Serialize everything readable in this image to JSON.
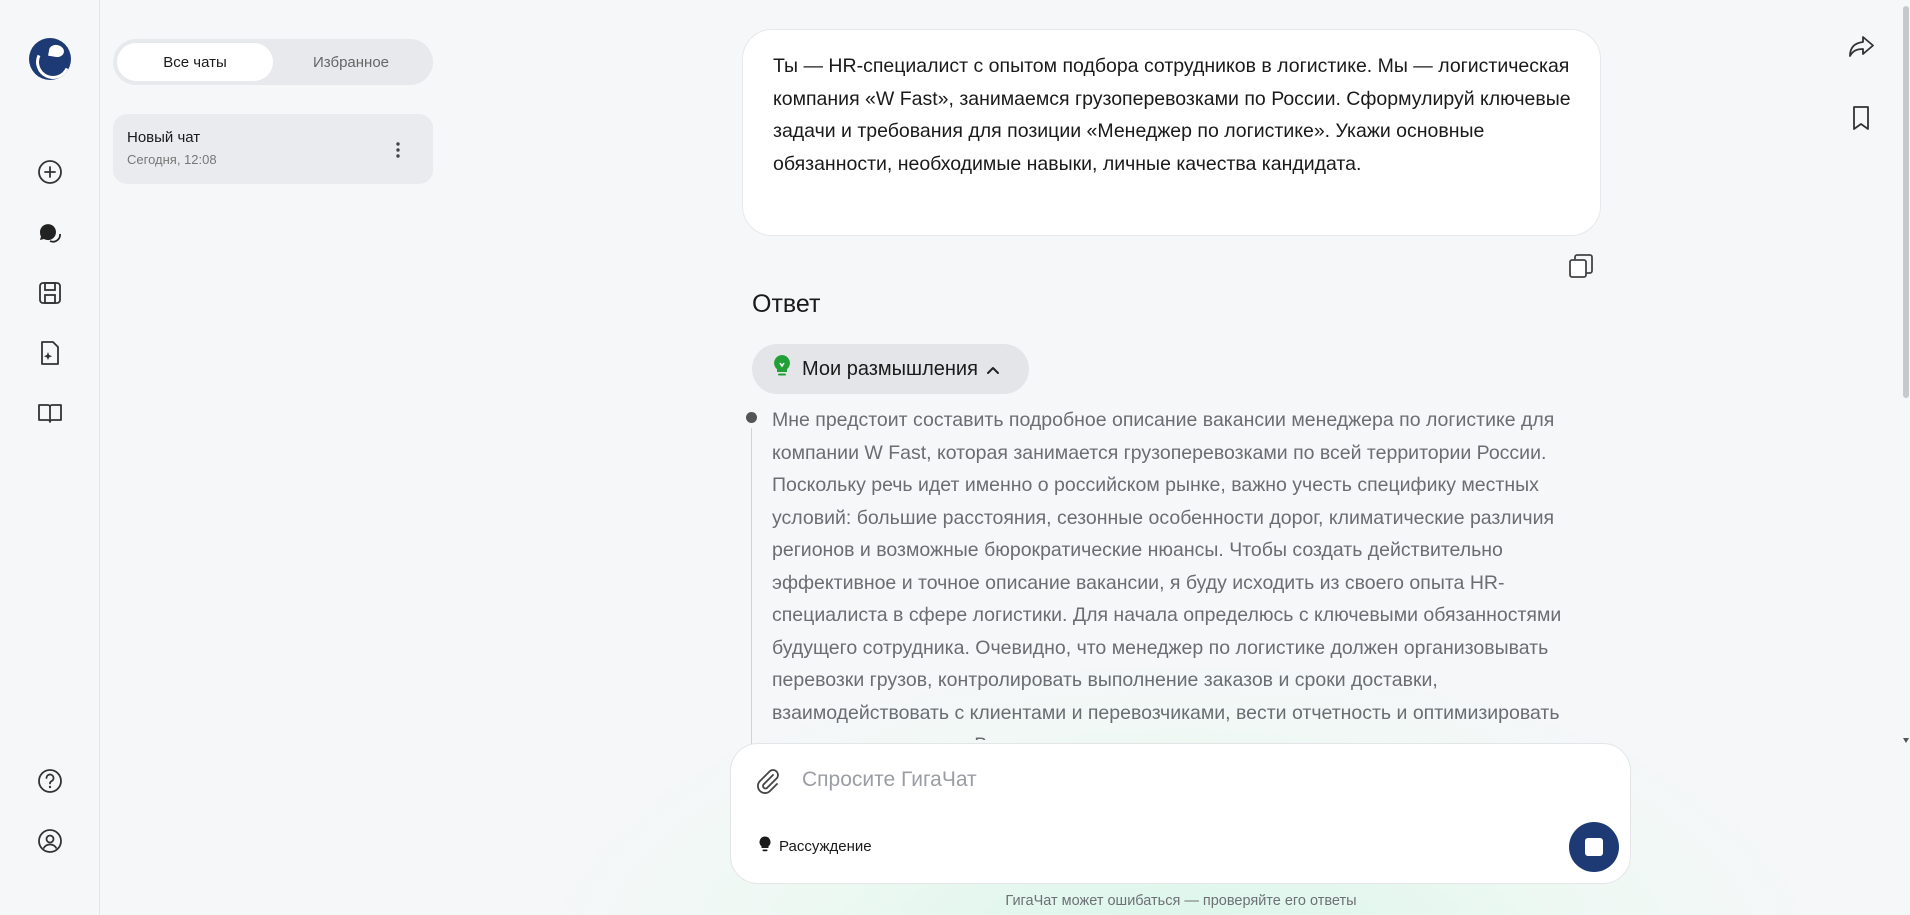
{
  "rail": {
    "icons": [
      "gigachat-logo-icon",
      "new-chat-icon",
      "chats-icon",
      "saved-icon",
      "files-ai-icon",
      "book-icon",
      "help-icon",
      "profile-icon"
    ]
  },
  "chat_list": {
    "tabs": [
      {
        "label": "Все чаты",
        "active": true
      },
      {
        "label": "Избранное",
        "active": false
      }
    ],
    "items": [
      {
        "title": "Новый чат",
        "time": "Сегодня, 12:08"
      }
    ]
  },
  "conversation": {
    "user_message": "Ты — HR-специалист с опытом подбора сотрудников в логистике. Мы — логистическая компания «W Fast», занимаемся грузоперевозками по России. Сформулируй ключевые задачи и требования для позиции «Менеджер по логистике». Укажи основные обязанности, необходимые навыки, личные качества кандидата.",
    "answer_title": "Ответ",
    "thoughts_label": "Мои размышления",
    "thoughts_text": "Мне предстоит составить подробное описание вакансии менеджера по логистике для компании W Fast, которая занимается грузоперевозками по всей территории России. Поскольку речь идет именно о российском рынке, важно учесть специфику местных условий: большие расстояния, сезонные особенности дорог, климатические различия регионов и возможные бюрократические нюансы. Чтобы создать действительно эффективное и точное описание вакансии, я буду исходить из своего опыта HR-специалиста в сфере логистики. Для начала определюсь с ключевыми обязанностями будущего сотрудника. Очевидно, что менеджер по логистике должен организовывать перевозки грузов, контролировать выполнение заказов и сроки доставки, взаимодействовать с клиентами и перевозчиками, вести отчетность и оптимизировать маршруты перевозок. Важно также предусмотреть"
  },
  "composer": {
    "placeholder": "Спросите ГигаЧат",
    "reasoning_label": "Рассуждение"
  },
  "footer": {
    "disclaimer": "ГигаЧат может ошибаться — проверяйте его ответы"
  },
  "colors": {
    "brand": "#1d3a74",
    "accent_green": "#21a038"
  }
}
